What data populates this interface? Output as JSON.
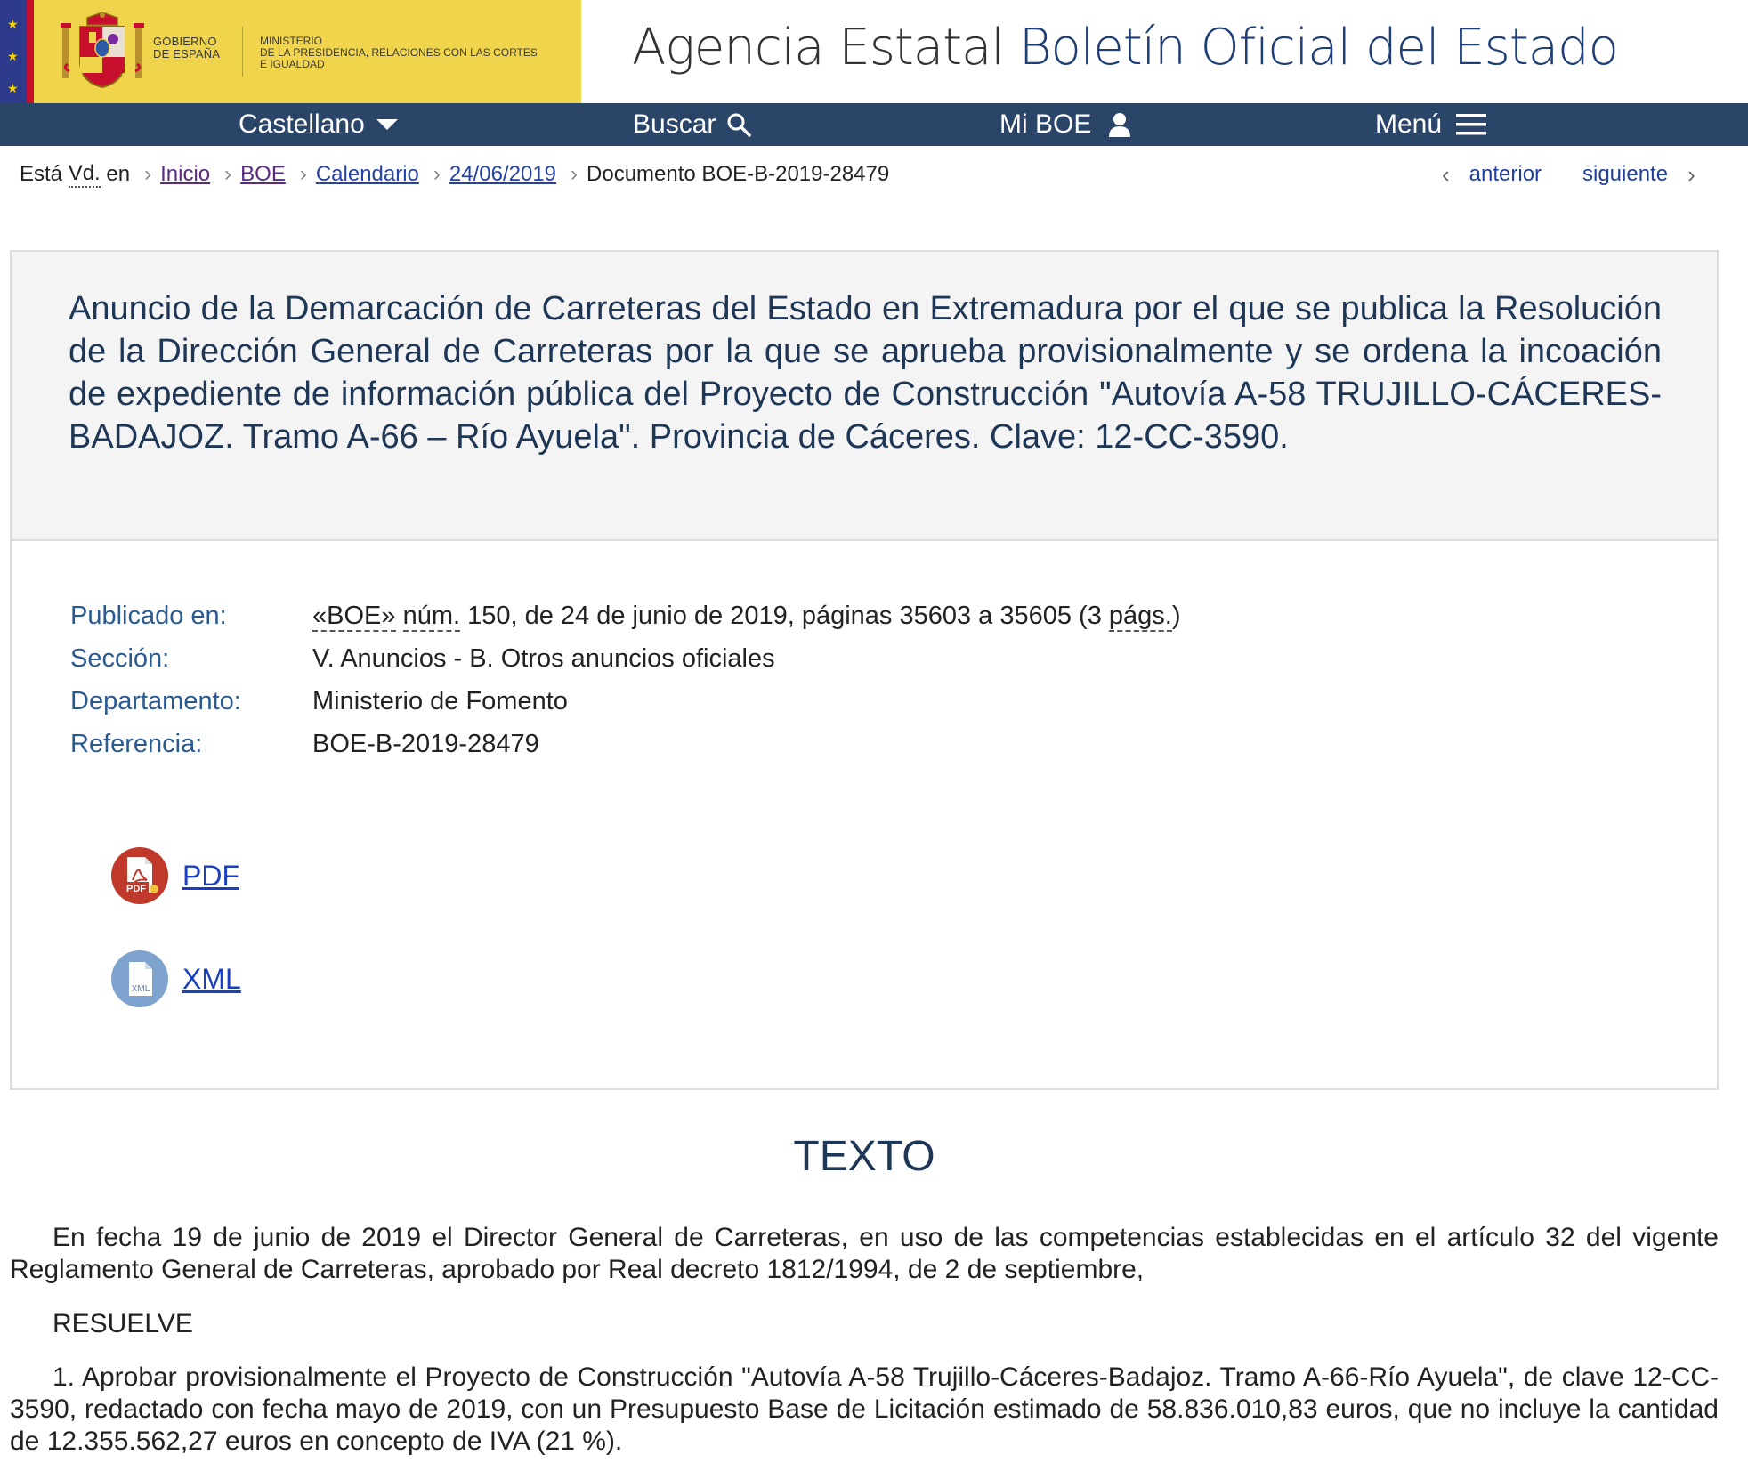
{
  "header": {
    "gov_line1": "GOBIERNO",
    "gov_line2": "DE ESPAÑA",
    "min_line1": "MINISTERIO",
    "min_line2": "DE LA PRESIDENCIA, RELACIONES CON LAS CORTES",
    "min_line3": "E IGUALDAD",
    "title_part1": "Agencia Estatal",
    "title_part2": "Boletín Oficial del Estado"
  },
  "nav": {
    "language": "Castellano",
    "search": "Buscar",
    "my_boe": "Mi BOE",
    "menu": "Menú"
  },
  "breadcrumb": {
    "prefix_1": "Está",
    "prefix_abbr": "Vd.",
    "prefix_2": "en",
    "items": [
      "Inicio",
      "BOE",
      "Calendario",
      "24/06/2019"
    ],
    "current": "Documento BOE-B-2019-28479"
  },
  "pager": {
    "prev": "anterior",
    "next": "siguiente"
  },
  "document": {
    "title": "Anuncio de la Demarcación de Carreteras del Estado en Extremadura por el que se publica la Resolución de la Dirección General de Carreteras por la que se aprueba provisionalmente y se ordena la incoación de expediente de información pública del Proyecto de Construcción \"Autovía A-58 TRUJILLO-CÁCERES-BADAJOZ. Tramo A-66 – Río Ayuela\". Provincia de Cáceres. Clave: 12-CC-3590.",
    "meta": {
      "published_label": "Publicado en:",
      "published_boe": "«BOE»",
      "published_num_abbr": "núm.",
      "published_rest": "150, de 24 de junio de 2019, páginas 35603 a 35605 (3",
      "published_pags_abbr": "págs.",
      "published_close": ")",
      "section_label": "Sección:",
      "section_value": "V. Anuncios - B. Otros anuncios oficiales",
      "department_label": "Departamento:",
      "department_value": "Ministerio de Fomento",
      "reference_label": "Referencia:",
      "reference_value": "BOE-B-2019-28479"
    },
    "downloads": {
      "pdf_label": "PDF",
      "pdf_icon_text": "PDF",
      "xml_label": "XML",
      "xml_icon_text": "XML"
    }
  },
  "texto": {
    "heading": "TEXTO",
    "paragraphs": [
      "En fecha 19 de junio de 2019 el Director General de Carreteras, en uso de las competencias establecidas en el artículo 32 del vigente Reglamento General de Carreteras, aprobado por Real decreto 1812/1994, de 2 de septiembre,",
      "RESUELVE",
      "1. Aprobar provisionalmente el Proyecto de Construcción \"Autovía A-58 Trujillo-Cáceres-Badajoz. Tramo A-66-Río Ayuela\", de clave 12-CC-3590, redactado con fecha mayo de 2019, con un Presupuesto Base de Licitación estimado de 58.836.010,83 euros, que no incluye la cantidad de 12.355.562,27 euros en concepto de IVA (21 %)."
    ]
  },
  "colors": {
    "nav_bg": "#2a4568",
    "gov_yellow": "#f0d44b",
    "title_blue": "#1f3e75",
    "pdf_red": "#c0392b",
    "xml_blue": "#7fa3cf"
  }
}
